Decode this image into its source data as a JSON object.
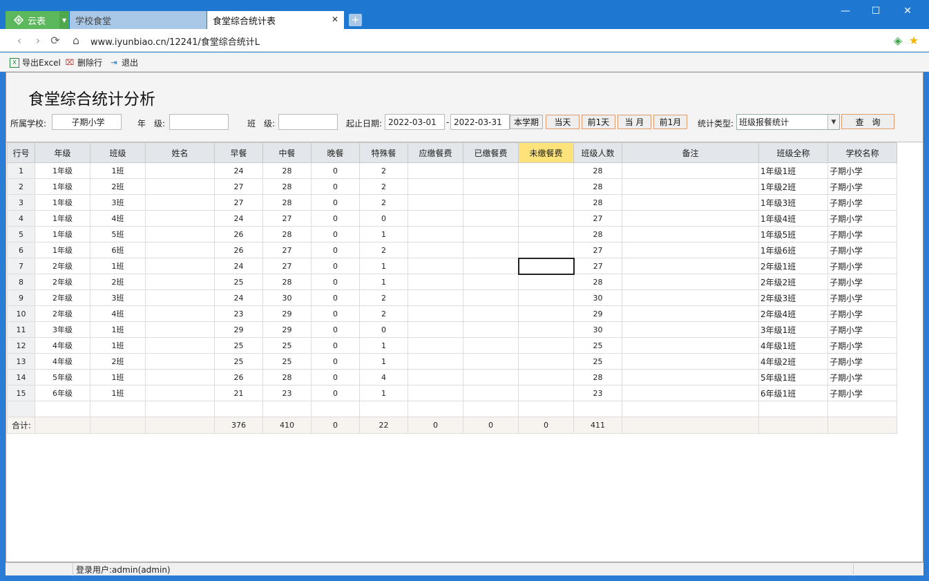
{
  "app": {
    "name": "云表"
  },
  "tabs": [
    {
      "label": "学校食堂"
    },
    {
      "label": "食堂综合统计表"
    }
  ],
  "address": {
    "url": "www.iyunbiao.cn/12241/食堂综合统计L"
  },
  "toolbar": {
    "export_label": "导出Excel",
    "delete_label": "删除行",
    "exit_label": "退出"
  },
  "page": {
    "title": "食堂综合统计分析"
  },
  "filters": {
    "school_label": "所属学校:",
    "school_value": "子期小学",
    "grade_label": "年　级:",
    "grade_value": "",
    "class_label": "班　级:",
    "class_value": "",
    "date_label": "起止日期:",
    "date_from": "2022-03-01",
    "date_sep": "-",
    "date_to": "2022-03-31",
    "btn_term": "本学期",
    "btn_today": "当天",
    "btn_prev_day": "前1天",
    "btn_month": "当 月",
    "btn_prev_month": "前1月",
    "stat_label": "统计类型:",
    "stat_value": "班级报餐统计",
    "query_label": "查　询"
  },
  "table": {
    "headers": [
      "行号",
      "年级",
      "班级",
      "姓名",
      "早餐",
      "中餐",
      "晚餐",
      "特殊餐",
      "应缴餐费",
      "已缴餐费",
      "未缴餐费",
      "班级人数",
      "备注",
      "班级全称",
      "学校名称"
    ],
    "rows": [
      [
        "1",
        "1年级",
        "1班",
        "",
        "24",
        "28",
        "0",
        "2",
        "",
        "",
        "",
        "28",
        "",
        "1年级1班",
        "子期小学"
      ],
      [
        "2",
        "1年级",
        "2班",
        "",
        "27",
        "28",
        "0",
        "2",
        "",
        "",
        "",
        "28",
        "",
        "1年级2班",
        "子期小学"
      ],
      [
        "3",
        "1年级",
        "3班",
        "",
        "27",
        "28",
        "0",
        "2",
        "",
        "",
        "",
        "28",
        "",
        "1年级3班",
        "子期小学"
      ],
      [
        "4",
        "1年级",
        "4班",
        "",
        "24",
        "27",
        "0",
        "0",
        "",
        "",
        "",
        "27",
        "",
        "1年级4班",
        "子期小学"
      ],
      [
        "5",
        "1年级",
        "5班",
        "",
        "26",
        "28",
        "0",
        "1",
        "",
        "",
        "",
        "28",
        "",
        "1年级5班",
        "子期小学"
      ],
      [
        "6",
        "1年级",
        "6班",
        "",
        "26",
        "27",
        "0",
        "2",
        "",
        "",
        "",
        "27",
        "",
        "1年级6班",
        "子期小学"
      ],
      [
        "7",
        "2年级",
        "1班",
        "",
        "24",
        "27",
        "0",
        "1",
        "",
        "",
        "",
        "27",
        "",
        "2年级1班",
        "子期小学"
      ],
      [
        "8",
        "2年级",
        "2班",
        "",
        "25",
        "28",
        "0",
        "1",
        "",
        "",
        "",
        "28",
        "",
        "2年级2班",
        "子期小学"
      ],
      [
        "9",
        "2年级",
        "3班",
        "",
        "24",
        "30",
        "0",
        "2",
        "",
        "",
        "",
        "30",
        "",
        "2年级3班",
        "子期小学"
      ],
      [
        "10",
        "2年级",
        "4班",
        "",
        "23",
        "29",
        "0",
        "2",
        "",
        "",
        "",
        "29",
        "",
        "2年级4班",
        "子期小学"
      ],
      [
        "11",
        "3年级",
        "1班",
        "",
        "29",
        "29",
        "0",
        "0",
        "",
        "",
        "",
        "30",
        "",
        "3年级1班",
        "子期小学"
      ],
      [
        "12",
        "4年级",
        "1班",
        "",
        "25",
        "25",
        "0",
        "1",
        "",
        "",
        "",
        "25",
        "",
        "4年级1班",
        "子期小学"
      ],
      [
        "13",
        "4年级",
        "2班",
        "",
        "25",
        "25",
        "0",
        "1",
        "",
        "",
        "",
        "25",
        "",
        "4年级2班",
        "子期小学"
      ],
      [
        "14",
        "5年级",
        "1班",
        "",
        "26",
        "28",
        "0",
        "4",
        "",
        "",
        "",
        "28",
        "",
        "5年级1班",
        "子期小学"
      ],
      [
        "15",
        "6年级",
        "1班",
        "",
        "21",
        "23",
        "0",
        "1",
        "",
        "",
        "",
        "23",
        "",
        "6年级1班",
        "子期小学"
      ]
    ],
    "total": [
      "合计:",
      "",
      "",
      "",
      "376",
      "410",
      "0",
      "22",
      "0",
      "0",
      "0",
      "411",
      "",
      "",
      ""
    ],
    "highlight_header_color": "#fde37a"
  },
  "status": {
    "user": "登录用户:admin(admin)"
  }
}
